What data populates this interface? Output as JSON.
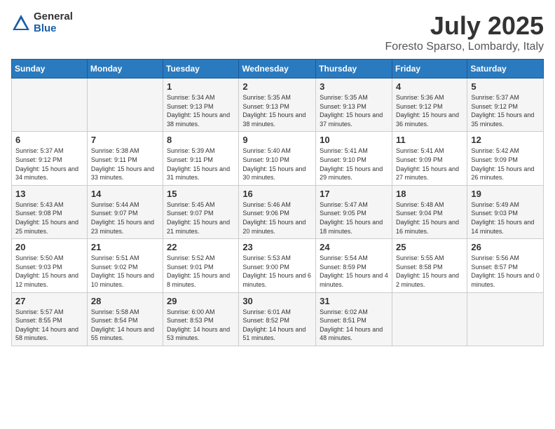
{
  "header": {
    "logo_general": "General",
    "logo_blue": "Blue",
    "title": "July 2025",
    "subtitle": "Foresto Sparso, Lombardy, Italy"
  },
  "days_of_week": [
    "Sunday",
    "Monday",
    "Tuesday",
    "Wednesday",
    "Thursday",
    "Friday",
    "Saturday"
  ],
  "weeks": [
    [
      {
        "day": "",
        "info": ""
      },
      {
        "day": "",
        "info": ""
      },
      {
        "day": "1",
        "info": "Sunrise: 5:34 AM\nSunset: 9:13 PM\nDaylight: 15 hours\nand 38 minutes."
      },
      {
        "day": "2",
        "info": "Sunrise: 5:35 AM\nSunset: 9:13 PM\nDaylight: 15 hours\nand 38 minutes."
      },
      {
        "day": "3",
        "info": "Sunrise: 5:35 AM\nSunset: 9:13 PM\nDaylight: 15 hours\nand 37 minutes."
      },
      {
        "day": "4",
        "info": "Sunrise: 5:36 AM\nSunset: 9:12 PM\nDaylight: 15 hours\nand 36 minutes."
      },
      {
        "day": "5",
        "info": "Sunrise: 5:37 AM\nSunset: 9:12 PM\nDaylight: 15 hours\nand 35 minutes."
      }
    ],
    [
      {
        "day": "6",
        "info": "Sunrise: 5:37 AM\nSunset: 9:12 PM\nDaylight: 15 hours\nand 34 minutes."
      },
      {
        "day": "7",
        "info": "Sunrise: 5:38 AM\nSunset: 9:11 PM\nDaylight: 15 hours\nand 33 minutes."
      },
      {
        "day": "8",
        "info": "Sunrise: 5:39 AM\nSunset: 9:11 PM\nDaylight: 15 hours\nand 31 minutes."
      },
      {
        "day": "9",
        "info": "Sunrise: 5:40 AM\nSunset: 9:10 PM\nDaylight: 15 hours\nand 30 minutes."
      },
      {
        "day": "10",
        "info": "Sunrise: 5:41 AM\nSunset: 9:10 PM\nDaylight: 15 hours\nand 29 minutes."
      },
      {
        "day": "11",
        "info": "Sunrise: 5:41 AM\nSunset: 9:09 PM\nDaylight: 15 hours\nand 27 minutes."
      },
      {
        "day": "12",
        "info": "Sunrise: 5:42 AM\nSunset: 9:09 PM\nDaylight: 15 hours\nand 26 minutes."
      }
    ],
    [
      {
        "day": "13",
        "info": "Sunrise: 5:43 AM\nSunset: 9:08 PM\nDaylight: 15 hours\nand 25 minutes."
      },
      {
        "day": "14",
        "info": "Sunrise: 5:44 AM\nSunset: 9:07 PM\nDaylight: 15 hours\nand 23 minutes."
      },
      {
        "day": "15",
        "info": "Sunrise: 5:45 AM\nSunset: 9:07 PM\nDaylight: 15 hours\nand 21 minutes."
      },
      {
        "day": "16",
        "info": "Sunrise: 5:46 AM\nSunset: 9:06 PM\nDaylight: 15 hours\nand 20 minutes."
      },
      {
        "day": "17",
        "info": "Sunrise: 5:47 AM\nSunset: 9:05 PM\nDaylight: 15 hours\nand 18 minutes."
      },
      {
        "day": "18",
        "info": "Sunrise: 5:48 AM\nSunset: 9:04 PM\nDaylight: 15 hours\nand 16 minutes."
      },
      {
        "day": "19",
        "info": "Sunrise: 5:49 AM\nSunset: 9:03 PM\nDaylight: 15 hours\nand 14 minutes."
      }
    ],
    [
      {
        "day": "20",
        "info": "Sunrise: 5:50 AM\nSunset: 9:03 PM\nDaylight: 15 hours\nand 12 minutes."
      },
      {
        "day": "21",
        "info": "Sunrise: 5:51 AM\nSunset: 9:02 PM\nDaylight: 15 hours\nand 10 minutes."
      },
      {
        "day": "22",
        "info": "Sunrise: 5:52 AM\nSunset: 9:01 PM\nDaylight: 15 hours\nand 8 minutes."
      },
      {
        "day": "23",
        "info": "Sunrise: 5:53 AM\nSunset: 9:00 PM\nDaylight: 15 hours\nand 6 minutes."
      },
      {
        "day": "24",
        "info": "Sunrise: 5:54 AM\nSunset: 8:59 PM\nDaylight: 15 hours\nand 4 minutes."
      },
      {
        "day": "25",
        "info": "Sunrise: 5:55 AM\nSunset: 8:58 PM\nDaylight: 15 hours\nand 2 minutes."
      },
      {
        "day": "26",
        "info": "Sunrise: 5:56 AM\nSunset: 8:57 PM\nDaylight: 15 hours\nand 0 minutes."
      }
    ],
    [
      {
        "day": "27",
        "info": "Sunrise: 5:57 AM\nSunset: 8:55 PM\nDaylight: 14 hours\nand 58 minutes."
      },
      {
        "day": "28",
        "info": "Sunrise: 5:58 AM\nSunset: 8:54 PM\nDaylight: 14 hours\nand 55 minutes."
      },
      {
        "day": "29",
        "info": "Sunrise: 6:00 AM\nSunset: 8:53 PM\nDaylight: 14 hours\nand 53 minutes."
      },
      {
        "day": "30",
        "info": "Sunrise: 6:01 AM\nSunset: 8:52 PM\nDaylight: 14 hours\nand 51 minutes."
      },
      {
        "day": "31",
        "info": "Sunrise: 6:02 AM\nSunset: 8:51 PM\nDaylight: 14 hours\nand 48 minutes."
      },
      {
        "day": "",
        "info": ""
      },
      {
        "day": "",
        "info": ""
      }
    ]
  ]
}
